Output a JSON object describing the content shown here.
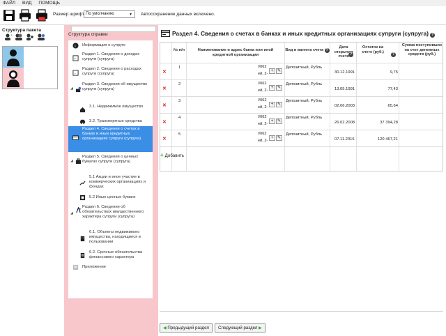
{
  "menu": [
    "ФАЙЛ",
    "ВИД",
    "ПОМОЩЬ"
  ],
  "toolbar": {
    "font_label": "Размер шрифта:",
    "font_value": "По умолчанию",
    "autosave": "Автосохранение данных включено."
  },
  "left": {
    "title": "Структура пакета"
  },
  "nav": {
    "title": "Структура справки",
    "items": [
      "Информация о супруге",
      "Раздел 1. Сведения о доходах супруги (супруга)",
      "Раздел 2. Сведения о расходах супруги (супруга)",
      "Раздел 3. Сведения об имуществе супруги (супруга)",
      "3.1. Недвижимое имущество",
      "3.2. Транспортные средства",
      "Раздел 4. Сведения о счетах в банках и иных кредитных организациях супруги (супруга)",
      "Раздел 5. Сведения о ценных бумагах супруги (супруга)",
      "5.1 Акции и иное участие в коммерческих организациях и фондах",
      "5.2 Иные ценные бумаги",
      "Раздел 6. Сведения об обязательствах имущественного характера супруги (супруга)",
      "6.1. Объекты недвижимого имущества, находящиеся в пользовании",
      "6.2. Срочные обязательства финансового характера",
      "Приложение"
    ]
  },
  "main": {
    "title": "Раздел 4. Сведения о счетах в банках и иных кредитных организациях супруги (супруга)",
    "columns": {
      "num": "№ п/п",
      "bank": "Наименование и адрес банка или иной кредитной организации",
      "type": "Вид и валюта счета",
      "date": "Дата открытия счета",
      "balance": "Остаток на счете (руб.)",
      "sum": "Сумма поступивших на счет денежных средств (руб.)"
    },
    "rows": [
      {
        "num": "1",
        "bank": "\\/062",
        "bank2": "ей, 2-",
        "type": "Депозитный, Рубль",
        "date": "30.12.1991",
        "balance": "9,75"
      },
      {
        "num": "2",
        "bank": "\\/062",
        "bank2": "ей, 2-",
        "type": "Депозитный, Рубль",
        "date": "13.05.1991",
        "balance": "77,43"
      },
      {
        "num": "3",
        "bank": "\\/062",
        "bank2": "ей, 2-",
        "type": "Депозитный, Рубль",
        "date": "02.06.2003",
        "balance": "65,64"
      },
      {
        "num": "4",
        "bank": "\\/062",
        "bank2": "ей, 2-",
        "type": "Депозитный, Рубль",
        "date": "26.02.2008",
        "balance": "37 394,28"
      },
      {
        "num": "5",
        "bank": "\\/062",
        "bank2": "ей, 2-",
        "type": "Депозитный, Рубль",
        "date": "07.11.2016",
        "balance": "120 467,21"
      }
    ],
    "add_label": "Добавить",
    "prev_label": "Предыдущий раздел",
    "next_label": "Следующий раздел",
    "help_glyph": "?"
  }
}
